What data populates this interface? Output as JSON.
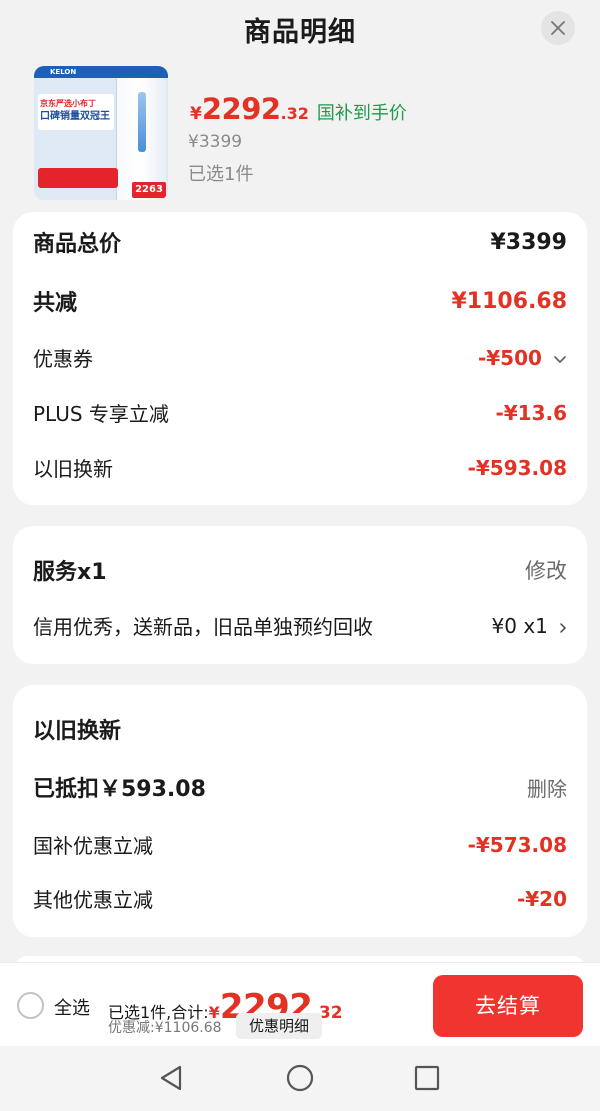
{
  "header": {
    "title": "商品明细"
  },
  "product": {
    "thumbnail": {
      "brand": "KELON",
      "headline_line1": "京东严选小布丁",
      "headline_line2": "口碑销量双冠王",
      "price_tag": "2263"
    },
    "price_symbol": "¥",
    "price_int": "2292",
    "price_dec": ".32",
    "subsidy_label": "国补到手价",
    "original_price": "¥3399",
    "selected_count": "已选1件"
  },
  "summary": {
    "total_label": "商品总价",
    "total_value": "¥3399",
    "reduce_label": "共减",
    "reduce_value": "¥1106.68",
    "items": [
      {
        "label": "优惠券",
        "value": "-¥500",
        "has_dropdown": true
      },
      {
        "label": "PLUS 专享立减",
        "value": "-¥13.6"
      },
      {
        "label": "以旧换新",
        "value": "-¥593.08"
      }
    ]
  },
  "service": {
    "title": "服务x1",
    "edit_label": "修改",
    "item_label": "信用优秀，送新品，旧品单独预约回收",
    "item_value": "¥0 x1"
  },
  "trade_in": {
    "title": "以旧换新",
    "deducted_label": "已抵扣￥593.08",
    "delete_label": "删除",
    "items": [
      {
        "label": "国补优惠立减",
        "value": "-¥573.08"
      },
      {
        "label": "其他优惠立减",
        "value": "-¥20"
      }
    ]
  },
  "bottom_bar": {
    "select_all_label": "全选",
    "total_prefix": "已选1件,合计:",
    "total_symbol": "¥",
    "total_int": "2292",
    "total_dec": ".32",
    "discount_text": "优惠减:¥1106.68",
    "detail_button": "优惠明细",
    "checkout_button": "去结算"
  },
  "colors": {
    "accent_red": "#e33224",
    "subsidy_green": "#1c9c4d",
    "checkout_red": "#f03530"
  },
  "icons": [
    "close-icon",
    "chevron-down-icon",
    "chevron-right-icon",
    "back-triangle-icon",
    "home-circle-icon",
    "recents-square-icon"
  ]
}
